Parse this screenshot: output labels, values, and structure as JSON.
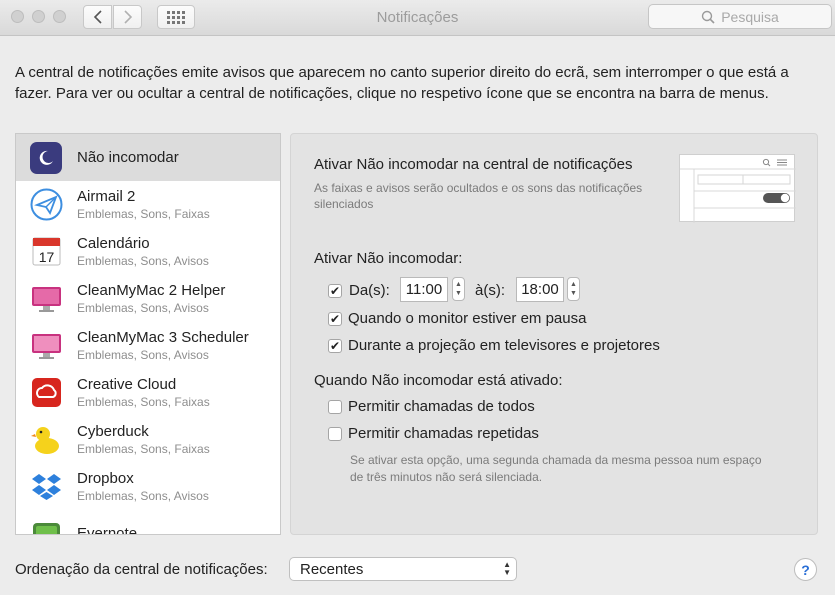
{
  "window": {
    "title": "Notificações",
    "search_placeholder": "Pesquisa"
  },
  "intro": "A central de notificações emite avisos que aparecem no canto superior direito do ecrã, sem interromper o que está a fazer. Para ver ou ocultar a central de notificações, clique no respetivo ícone que se encontra na barra de menus.",
  "sidebar": {
    "dnd_label": "Não incomodar",
    "apps": [
      {
        "name": "Airmail 2",
        "sub": "Emblemas, Sons, Faixas",
        "icon": "airmail-icon"
      },
      {
        "name": "Calendário",
        "sub": "Emblemas, Sons, Avisos",
        "icon": "calendar-icon"
      },
      {
        "name": "CleanMyMac 2 Helper",
        "sub": "Emblemas, Sons, Avisos",
        "icon": "cleanmymac-icon"
      },
      {
        "name": "CleanMyMac 3 Scheduler",
        "sub": "Emblemas, Sons, Avisos",
        "icon": "cleanmymac-icon"
      },
      {
        "name": "Creative Cloud",
        "sub": "Emblemas, Sons, Faixas",
        "icon": "creative-cloud-icon"
      },
      {
        "name": "Cyberduck",
        "sub": "Emblemas, Sons, Faixas",
        "icon": "cyberduck-icon"
      },
      {
        "name": "Dropbox",
        "sub": "Emblemas, Sons, Avisos",
        "icon": "dropbox-icon"
      },
      {
        "name": "Evernote",
        "sub": "",
        "icon": "evernote-icon"
      }
    ],
    "calendar_day": "17"
  },
  "panel": {
    "title": "Ativar Não incomodar na central de notificações",
    "description": "As faixas e avisos serão ocultados e os sons das notificações silenciados",
    "section1": "Ativar Não incomodar:",
    "from_label": "Da(s):",
    "from_time": "11:00",
    "to_label": "à(s):",
    "to_time": "18:00",
    "from_checked": true,
    "option_sleep": "Quando o monitor estiver em pausa",
    "option_sleep_checked": true,
    "option_mirror": "Durante a projeção em televisores e projetores",
    "option_mirror_checked": true,
    "section2": "Quando Não incomodar está ativado:",
    "allow_calls": "Permitir chamadas de todos",
    "allow_calls_checked": false,
    "allow_repeated": "Permitir chamadas repetidas",
    "allow_repeated_checked": false,
    "note": "Se ativar esta opção, uma segunda chamada da mesma pessoa num espaço de três minutos não será silenciada."
  },
  "bottom": {
    "sort_label": "Ordenação da central de notificações:",
    "sort_value": "Recentes",
    "help": "?"
  },
  "colors": {
    "dnd_icon_bg": "#3a3b7e",
    "selection": "#dcdcdc",
    "help_accent": "#2a6fd6"
  }
}
